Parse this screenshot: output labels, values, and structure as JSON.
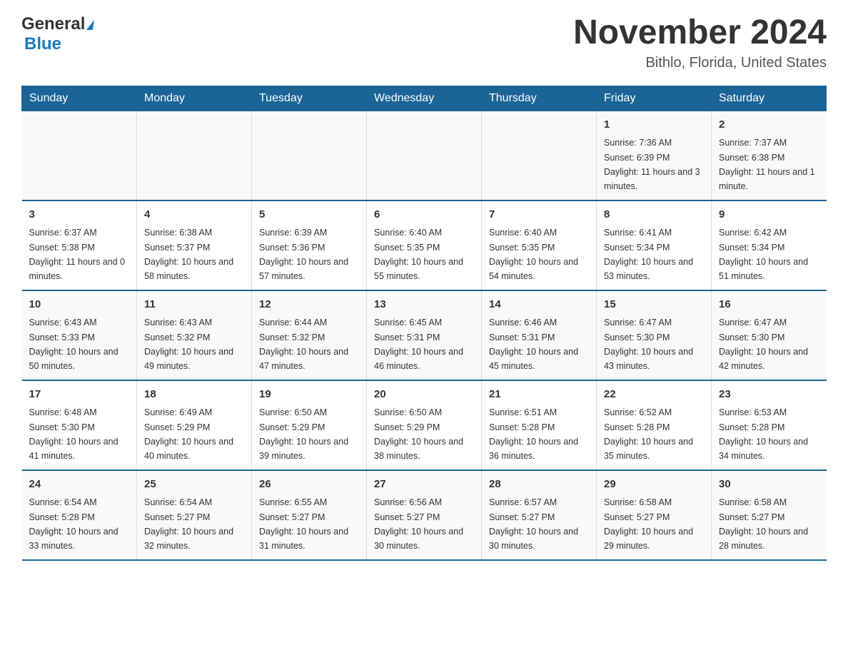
{
  "logo": {
    "general": "General",
    "blue": "Blue",
    "arrow_char": "▶"
  },
  "title": "November 2024",
  "subtitle": "Bithlo, Florida, United States",
  "days_header": [
    "Sunday",
    "Monday",
    "Tuesday",
    "Wednesday",
    "Thursday",
    "Friday",
    "Saturday"
  ],
  "weeks": [
    [
      {
        "day": "",
        "info": ""
      },
      {
        "day": "",
        "info": ""
      },
      {
        "day": "",
        "info": ""
      },
      {
        "day": "",
        "info": ""
      },
      {
        "day": "",
        "info": ""
      },
      {
        "day": "1",
        "info": "Sunrise: 7:36 AM\nSunset: 6:39 PM\nDaylight: 11 hours and 3 minutes."
      },
      {
        "day": "2",
        "info": "Sunrise: 7:37 AM\nSunset: 6:38 PM\nDaylight: 11 hours and 1 minute."
      }
    ],
    [
      {
        "day": "3",
        "info": "Sunrise: 6:37 AM\nSunset: 5:38 PM\nDaylight: 11 hours and 0 minutes."
      },
      {
        "day": "4",
        "info": "Sunrise: 6:38 AM\nSunset: 5:37 PM\nDaylight: 10 hours and 58 minutes."
      },
      {
        "day": "5",
        "info": "Sunrise: 6:39 AM\nSunset: 5:36 PM\nDaylight: 10 hours and 57 minutes."
      },
      {
        "day": "6",
        "info": "Sunrise: 6:40 AM\nSunset: 5:35 PM\nDaylight: 10 hours and 55 minutes."
      },
      {
        "day": "7",
        "info": "Sunrise: 6:40 AM\nSunset: 5:35 PM\nDaylight: 10 hours and 54 minutes."
      },
      {
        "day": "8",
        "info": "Sunrise: 6:41 AM\nSunset: 5:34 PM\nDaylight: 10 hours and 53 minutes."
      },
      {
        "day": "9",
        "info": "Sunrise: 6:42 AM\nSunset: 5:34 PM\nDaylight: 10 hours and 51 minutes."
      }
    ],
    [
      {
        "day": "10",
        "info": "Sunrise: 6:43 AM\nSunset: 5:33 PM\nDaylight: 10 hours and 50 minutes."
      },
      {
        "day": "11",
        "info": "Sunrise: 6:43 AM\nSunset: 5:32 PM\nDaylight: 10 hours and 49 minutes."
      },
      {
        "day": "12",
        "info": "Sunrise: 6:44 AM\nSunset: 5:32 PM\nDaylight: 10 hours and 47 minutes."
      },
      {
        "day": "13",
        "info": "Sunrise: 6:45 AM\nSunset: 5:31 PM\nDaylight: 10 hours and 46 minutes."
      },
      {
        "day": "14",
        "info": "Sunrise: 6:46 AM\nSunset: 5:31 PM\nDaylight: 10 hours and 45 minutes."
      },
      {
        "day": "15",
        "info": "Sunrise: 6:47 AM\nSunset: 5:30 PM\nDaylight: 10 hours and 43 minutes."
      },
      {
        "day": "16",
        "info": "Sunrise: 6:47 AM\nSunset: 5:30 PM\nDaylight: 10 hours and 42 minutes."
      }
    ],
    [
      {
        "day": "17",
        "info": "Sunrise: 6:48 AM\nSunset: 5:30 PM\nDaylight: 10 hours and 41 minutes."
      },
      {
        "day": "18",
        "info": "Sunrise: 6:49 AM\nSunset: 5:29 PM\nDaylight: 10 hours and 40 minutes."
      },
      {
        "day": "19",
        "info": "Sunrise: 6:50 AM\nSunset: 5:29 PM\nDaylight: 10 hours and 39 minutes."
      },
      {
        "day": "20",
        "info": "Sunrise: 6:50 AM\nSunset: 5:29 PM\nDaylight: 10 hours and 38 minutes."
      },
      {
        "day": "21",
        "info": "Sunrise: 6:51 AM\nSunset: 5:28 PM\nDaylight: 10 hours and 36 minutes."
      },
      {
        "day": "22",
        "info": "Sunrise: 6:52 AM\nSunset: 5:28 PM\nDaylight: 10 hours and 35 minutes."
      },
      {
        "day": "23",
        "info": "Sunrise: 6:53 AM\nSunset: 5:28 PM\nDaylight: 10 hours and 34 minutes."
      }
    ],
    [
      {
        "day": "24",
        "info": "Sunrise: 6:54 AM\nSunset: 5:28 PM\nDaylight: 10 hours and 33 minutes."
      },
      {
        "day": "25",
        "info": "Sunrise: 6:54 AM\nSunset: 5:27 PM\nDaylight: 10 hours and 32 minutes."
      },
      {
        "day": "26",
        "info": "Sunrise: 6:55 AM\nSunset: 5:27 PM\nDaylight: 10 hours and 31 minutes."
      },
      {
        "day": "27",
        "info": "Sunrise: 6:56 AM\nSunset: 5:27 PM\nDaylight: 10 hours and 30 minutes."
      },
      {
        "day": "28",
        "info": "Sunrise: 6:57 AM\nSunset: 5:27 PM\nDaylight: 10 hours and 30 minutes."
      },
      {
        "day": "29",
        "info": "Sunrise: 6:58 AM\nSunset: 5:27 PM\nDaylight: 10 hours and 29 minutes."
      },
      {
        "day": "30",
        "info": "Sunrise: 6:58 AM\nSunset: 5:27 PM\nDaylight: 10 hours and 28 minutes."
      }
    ]
  ]
}
